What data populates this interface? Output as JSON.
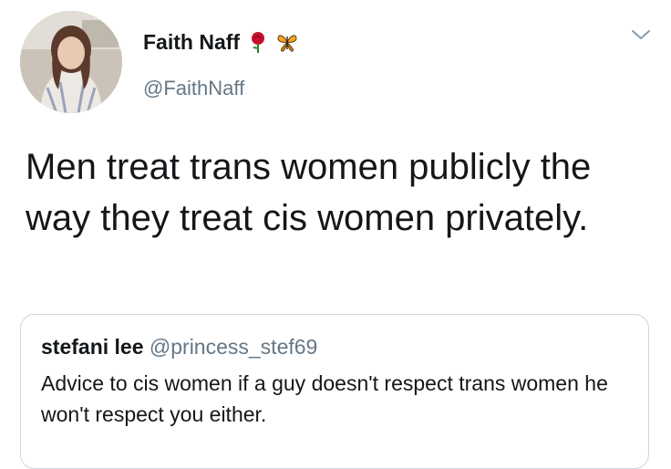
{
  "tweet": {
    "author": {
      "display_name": "Faith Naff",
      "handle": "@FaithNaff",
      "emojis": [
        "rose-icon",
        "butterfly-icon"
      ]
    },
    "text": "Men treat trans women publicly the way they treat cis women privately.",
    "quoted": {
      "display_name": "stefani lee",
      "handle": "@princess_stef69",
      "text": "Advice to cis women if a guy doesn't respect trans women he won't respect you either."
    }
  },
  "colors": {
    "text": "#14171a",
    "secondary_text": "#657786",
    "border": "#ccd6dd"
  }
}
